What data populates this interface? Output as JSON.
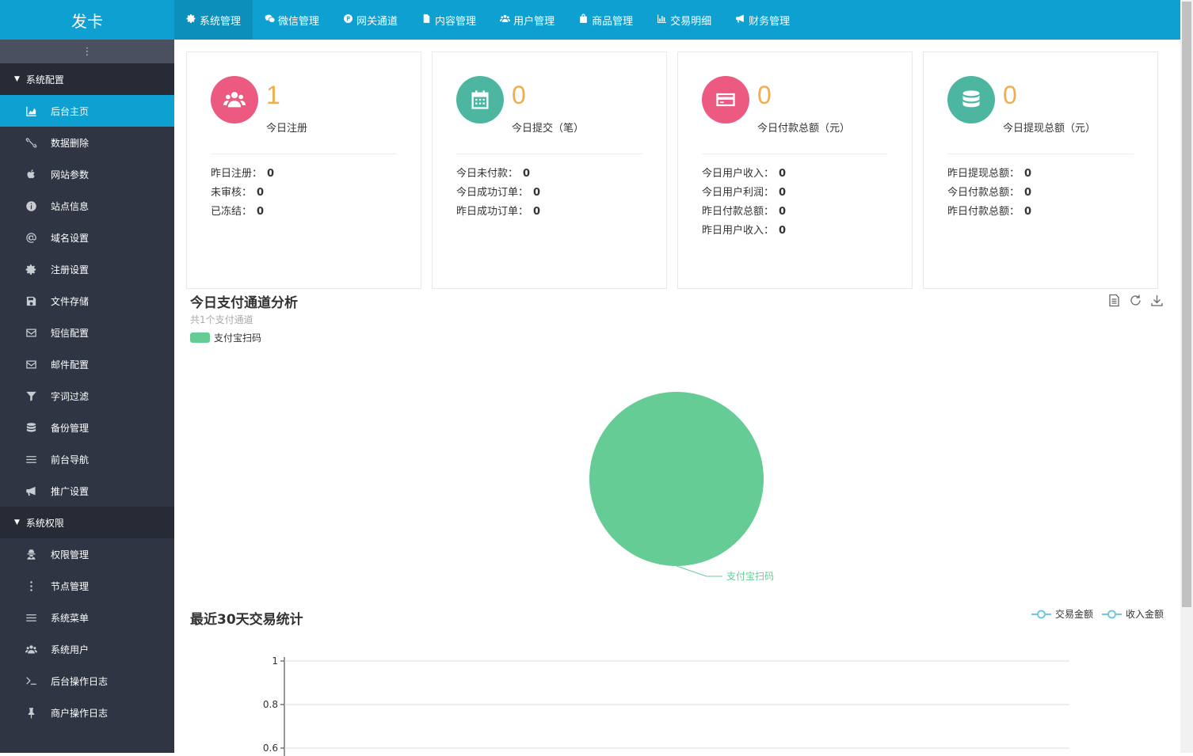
{
  "brand": "发卡",
  "topnav": [
    {
      "label": "系统管理",
      "icon": "gear-icon"
    },
    {
      "label": "微信管理",
      "icon": "wechat-icon"
    },
    {
      "label": "网关通道",
      "icon": "gateway-icon"
    },
    {
      "label": "内容管理",
      "icon": "document-icon"
    },
    {
      "label": "用户管理",
      "icon": "users-icon"
    },
    {
      "label": "商品管理",
      "icon": "bag-icon"
    },
    {
      "label": "交易明细",
      "icon": "bar-chart-icon"
    },
    {
      "label": "财务管理",
      "icon": "bullhorn-icon"
    }
  ],
  "sidebar": {
    "toggle": "⋮",
    "groups": [
      {
        "label": "系统配置",
        "items": [
          {
            "label": "后台主页",
            "icon": "area-chart-icon"
          },
          {
            "label": "数据删除",
            "icon": "link-icon"
          },
          {
            "label": "网站参数",
            "icon": "apple-icon"
          },
          {
            "label": "站点信息",
            "icon": "info-icon"
          },
          {
            "label": "域名设置",
            "icon": "at-icon"
          },
          {
            "label": "注册设置",
            "icon": "gear-icon"
          },
          {
            "label": "文件存储",
            "icon": "save-icon"
          },
          {
            "label": "短信配置",
            "icon": "envelope-icon"
          },
          {
            "label": "邮件配置",
            "icon": "envelope-icon"
          },
          {
            "label": "字词过滤",
            "icon": "filter-icon"
          },
          {
            "label": "备份管理",
            "icon": "database-icon"
          },
          {
            "label": "前台导航",
            "icon": "list-icon"
          },
          {
            "label": "推广设置",
            "icon": "bullhorn-icon"
          }
        ]
      },
      {
        "label": "系统权限",
        "items": [
          {
            "label": "权限管理",
            "icon": "user-secret-icon"
          },
          {
            "label": "节点管理",
            "icon": "ellipsis-icon"
          },
          {
            "label": "系统菜单",
            "icon": "list-icon"
          },
          {
            "label": "系统用户",
            "icon": "users-icon"
          },
          {
            "label": "后台操作日志",
            "icon": "terminal-icon"
          },
          {
            "label": "商户操作日志",
            "icon": "pin-icon"
          }
        ]
      }
    ]
  },
  "cards": [
    {
      "value": "1",
      "label": "今日注册",
      "color": "#ec5a82",
      "icon": "users-icon",
      "rows": [
        {
          "k": "昨日注册：",
          "v": "0"
        },
        {
          "k": "未审核：",
          "v": "0"
        },
        {
          "k": "已冻结：",
          "v": "0"
        }
      ]
    },
    {
      "value": "0",
      "label": "今日提交（笔）",
      "color": "#4db6a0",
      "icon": "calendar-icon",
      "rows": [
        {
          "k": "今日未付款：",
          "v": "0"
        },
        {
          "k": "今日成功订单：",
          "v": "0"
        },
        {
          "k": "昨日成功订单：",
          "v": "0"
        }
      ]
    },
    {
      "value": "0",
      "label": "今日付款总额（元）",
      "color": "#ec5a82",
      "icon": "credit-card-icon",
      "rows": [
        {
          "k": "今日用户收入：",
          "v": "0"
        },
        {
          "k": "今日用户利润：",
          "v": "0"
        },
        {
          "k": "昨日付款总额：",
          "v": "0"
        },
        {
          "k": "昨日用户收入：",
          "v": "0"
        }
      ]
    },
    {
      "value": "0",
      "label": "今日提现总额（元）",
      "color": "#4db6a0",
      "icon": "database-icon",
      "rows": [
        {
          "k": "昨日提现总额：",
          "v": "0"
        },
        {
          "k": "今日付款总额：",
          "v": "0"
        },
        {
          "k": "昨日付款总额：",
          "v": "0"
        }
      ]
    }
  ],
  "pie_section": {
    "title": "今日支付通道分析",
    "subtitle": "共1个支付通道",
    "legend": "支付宝扫码",
    "callout": "支付宝扫码",
    "color": "#66cc96"
  },
  "line_section": {
    "title": "最近30天交易统计",
    "legend": [
      {
        "name": "交易金额",
        "color": "#6fc8d8"
      },
      {
        "name": "收入金额",
        "color": "#6fc8d8"
      }
    ],
    "yticks": [
      "1",
      "0.8",
      "0.6"
    ]
  },
  "chart_data": [
    {
      "type": "pie",
      "title": "今日支付通道分析",
      "categories": [
        "支付宝扫码"
      ],
      "values": [
        1
      ],
      "legend": "top-left"
    },
    {
      "type": "line",
      "title": "最近30天交易统计",
      "series": [
        {
          "name": "交易金额",
          "values": []
        },
        {
          "name": "收入金额",
          "values": []
        }
      ],
      "ylim": [
        0,
        1
      ],
      "legend": "top-right",
      "grid": true
    }
  ]
}
